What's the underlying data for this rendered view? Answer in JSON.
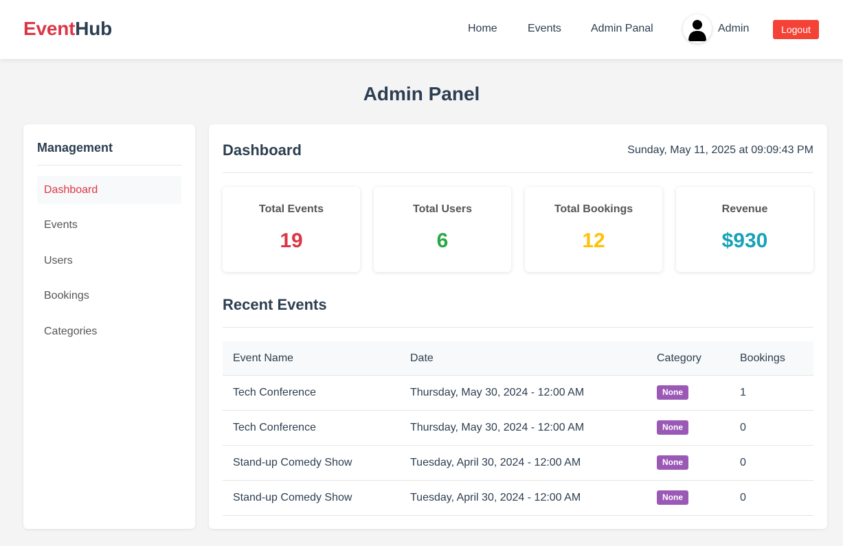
{
  "brand": {
    "part1": "Event",
    "part2": "Hub",
    "accent_color": "#dc3545"
  },
  "nav": {
    "home": "Home",
    "events": "Events",
    "admin_panal": "Admin Panal",
    "user_name": "Admin",
    "logout": "Logout",
    "avatar_icon": "user-icon"
  },
  "page_title": "Admin Panel",
  "sidebar": {
    "heading": "Management",
    "items": [
      {
        "label": "Dashboard",
        "active": true
      },
      {
        "label": "Events"
      },
      {
        "label": "Users"
      },
      {
        "label": "Bookings"
      },
      {
        "label": "Categories"
      }
    ]
  },
  "dashboard": {
    "title": "Dashboard",
    "datetime": "Sunday, May 11, 2025 at 09:09:43 PM",
    "stats": [
      {
        "label": "Total Events",
        "value": "19",
        "color": "#dc3545"
      },
      {
        "label": "Total Users",
        "value": "6",
        "color": "#28a745"
      },
      {
        "label": "Total Bookings",
        "value": "12",
        "color": "#ffc107"
      },
      {
        "label": "Revenue",
        "value": "$930",
        "color": "#17a2b8"
      }
    ]
  },
  "recent_events": {
    "title": "Recent Events",
    "columns": [
      "Event Name",
      "Date",
      "Category",
      "Bookings"
    ],
    "rows": [
      {
        "name": "Tech Conference",
        "date": "Thursday, May 30, 2024 - 12:00 AM",
        "category": "None",
        "bookings": "1"
      },
      {
        "name": "Tech Conference",
        "date": "Thursday, May 30, 2024 - 12:00 AM",
        "category": "None",
        "bookings": "0"
      },
      {
        "name": "Stand-up Comedy Show",
        "date": "Tuesday, April 30, 2024 - 12:00 AM",
        "category": "None",
        "bookings": "0"
      },
      {
        "name": "Stand-up Comedy Show",
        "date": "Tuesday, April 30, 2024 - 12:00 AM",
        "category": "None",
        "bookings": "0"
      }
    ],
    "badge_color": "#9b59b6"
  }
}
